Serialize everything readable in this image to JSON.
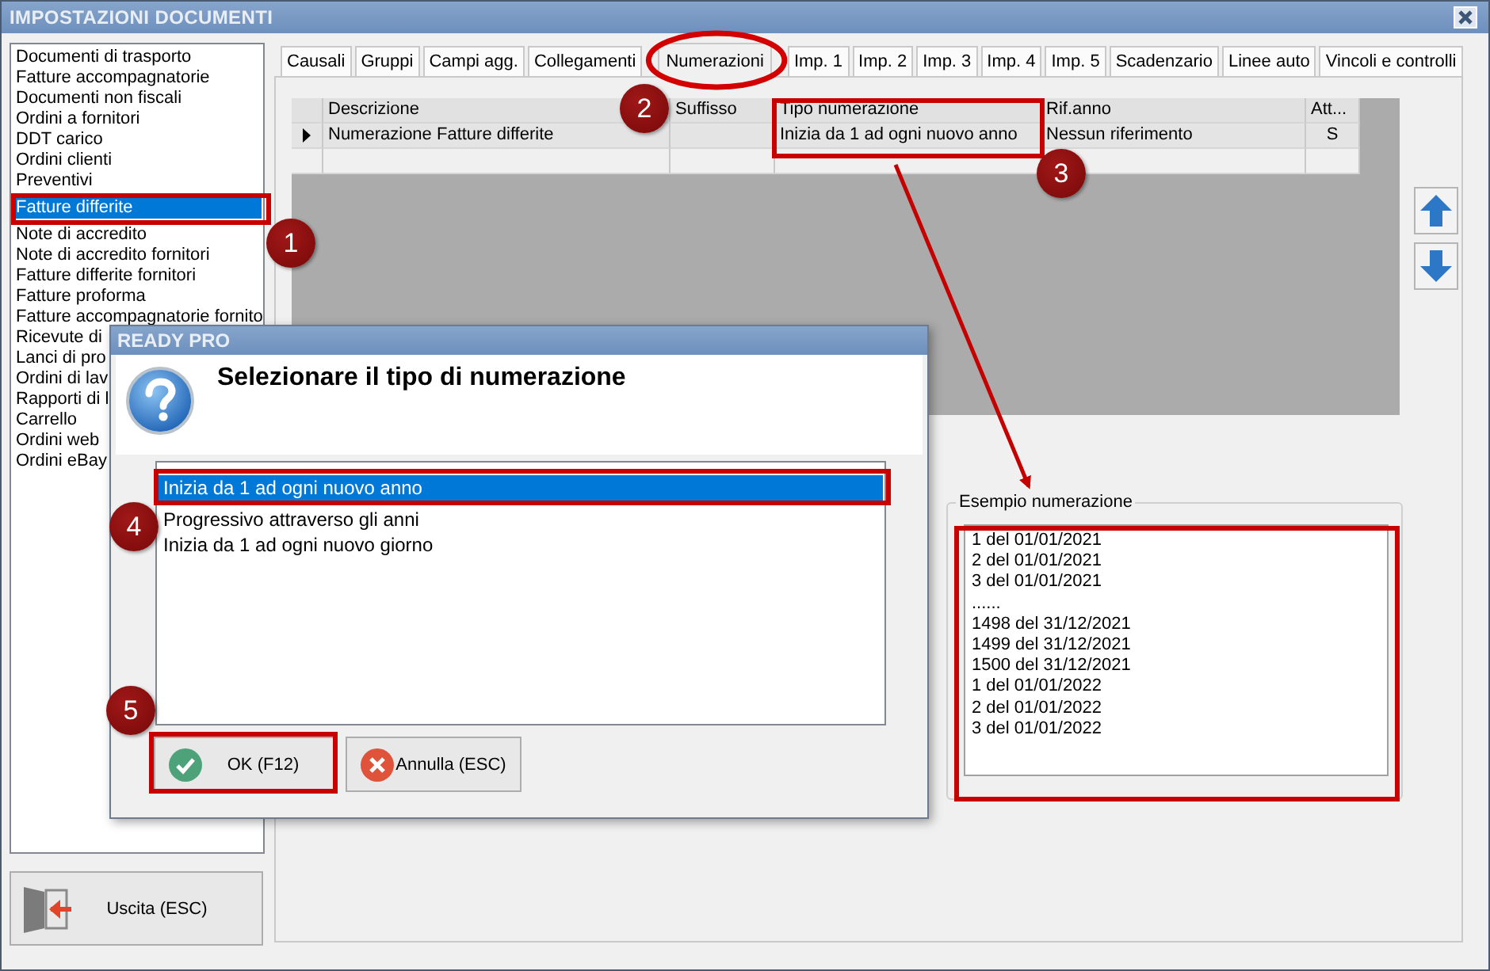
{
  "window": {
    "title": "IMPOSTAZIONI DOCUMENTI"
  },
  "document_types": [
    {
      "label": "Documenti di trasporto",
      "selected": false
    },
    {
      "label": "Fatture accompagnatorie",
      "selected": false
    },
    {
      "label": "Documenti non fiscali",
      "selected": false
    },
    {
      "label": "Ordini a fornitori",
      "selected": false
    },
    {
      "label": "DDT carico",
      "selected": false
    },
    {
      "label": "Ordini clienti",
      "selected": false
    },
    {
      "label": "Preventivi",
      "selected": false
    },
    {
      "label": "Fatture differite",
      "selected": true
    },
    {
      "label": "Note di accredito",
      "selected": false
    },
    {
      "label": "Note di accredito fornitori",
      "selected": false
    },
    {
      "label": "Fatture differite fornitori",
      "selected": false
    },
    {
      "label": "Fatture proforma",
      "selected": false
    },
    {
      "label": "Fatture accompagnatorie fornito",
      "selected": false
    },
    {
      "label": "Ricevute di",
      "selected": false
    },
    {
      "label": "Lanci di pro",
      "selected": false
    },
    {
      "label": "Ordini di lav",
      "selected": false
    },
    {
      "label": "Rapporti di l",
      "selected": false
    },
    {
      "label": "Carrello",
      "selected": false
    },
    {
      "label": "Ordini web",
      "selected": false
    },
    {
      "label": "Ordini eBay",
      "selected": false
    }
  ],
  "tabs": [
    {
      "label": "Causali",
      "selected": false
    },
    {
      "label": "Gruppi",
      "selected": false
    },
    {
      "label": "Campi agg.",
      "selected": false
    },
    {
      "label": "Collegamenti",
      "selected": false
    },
    {
      "label": "Numerazioni",
      "selected": true
    },
    {
      "label": "Imp. 1",
      "selected": false
    },
    {
      "label": "Imp. 2",
      "selected": false
    },
    {
      "label": "Imp. 3",
      "selected": false
    },
    {
      "label": "Imp. 4",
      "selected": false
    },
    {
      "label": "Imp. 5",
      "selected": false
    },
    {
      "label": "Scadenzario",
      "selected": false
    },
    {
      "label": "Linee auto",
      "selected": false
    },
    {
      "label": "Vincoli e controlli",
      "selected": false
    }
  ],
  "grid": {
    "columns": [
      "Descrizione",
      "Suffisso",
      "Tipo numerazione",
      "Rif.anno",
      "Att..."
    ],
    "rows": [
      {
        "current": true,
        "cells": [
          "Numerazione Fatture differite",
          "",
          "Inizia da 1 ad ogni nuovo anno",
          "Nessun riferimento",
          "S"
        ]
      }
    ]
  },
  "example": {
    "title": "Esempio numerazione",
    "lines": [
      "1 del 01/01/2021",
      "2 del 01/01/2021",
      "3 del 01/01/2021",
      "......",
      "1498 del 31/12/2021",
      "1499 del 31/12/2021",
      "1500 del 31/12/2021",
      "1 del 01/01/2022",
      "2 del 01/01/2022",
      "3 del 01/01/2022"
    ]
  },
  "exit_button": {
    "label": "Uscita (ESC)"
  },
  "dialog": {
    "title": "READY PRO",
    "prompt": "Selezionare il tipo di numerazione",
    "options": [
      {
        "label": "Inizia da 1 ad ogni nuovo anno",
        "selected": true
      },
      {
        "label": "Progressivo attraverso gli anni",
        "selected": false
      },
      {
        "label": "Inizia da 1 ad ogni nuovo giorno",
        "selected": false
      }
    ],
    "buttons": [
      {
        "label": "OK (F12)",
        "kind": "ok"
      },
      {
        "label": "Annulla (ESC)",
        "kind": "cancel"
      }
    ]
  },
  "annotations": [
    {
      "number": "1"
    },
    {
      "number": "2"
    },
    {
      "number": "3"
    },
    {
      "number": "4"
    },
    {
      "number": "5"
    }
  ]
}
